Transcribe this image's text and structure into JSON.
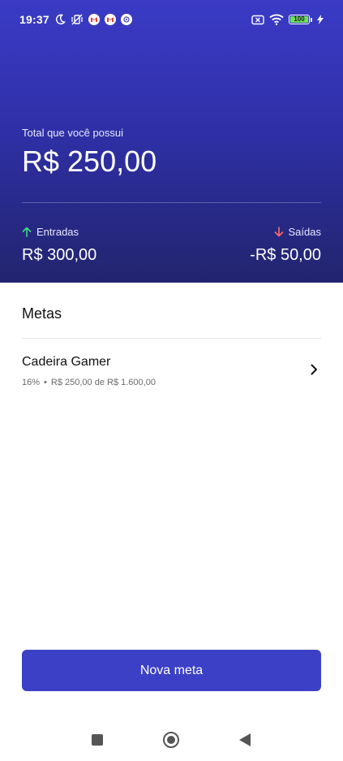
{
  "status_bar": {
    "time": "19:37",
    "battery_level": "100",
    "icons": [
      "moon-icon",
      "mute-vibrate-icon",
      "gmail-icon",
      "gmail-icon",
      "app-notification-icon",
      "no-sim-icon",
      "wifi-icon",
      "battery-icon",
      "charging-icon"
    ]
  },
  "summary": {
    "total_label": "Total que você possui",
    "total_value": "R$ 250,00",
    "income_label": "Entradas",
    "income_value": "R$ 300,00",
    "expense_label": "Saídas",
    "expense_value": "-R$ 50,00"
  },
  "goals": {
    "title": "Metas",
    "items": [
      {
        "name": "Cadeira Gamer",
        "percent": "16%",
        "separator": "•",
        "progress_text": "R$ 250,00 de R$ 1.600,00"
      }
    ]
  },
  "actions": {
    "new_goal_label": "Nova meta"
  },
  "nav": {
    "icons": [
      "recent-apps-icon",
      "home-icon",
      "back-icon"
    ]
  },
  "colors": {
    "header_top": "#3a3bc6",
    "header_bottom": "#22246e",
    "primary": "#3c40c6",
    "income_arrow": "#3ddc84",
    "expense_arrow": "#ff6b6b"
  }
}
